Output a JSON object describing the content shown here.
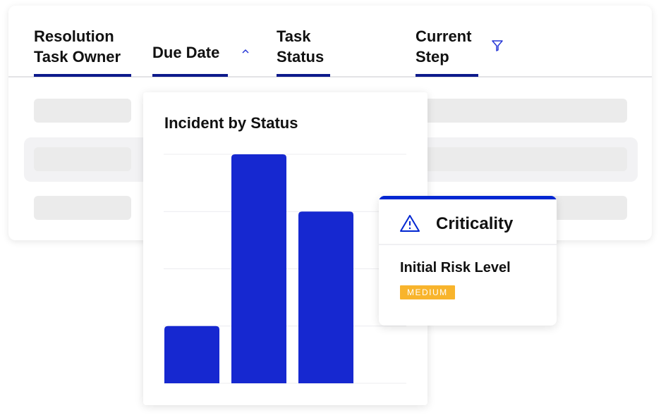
{
  "table": {
    "columns": [
      {
        "label_line1": "Resolution",
        "label_line2": "Task Owner"
      },
      {
        "label_line1": "Due Date",
        "label_line2": "",
        "icon": "sort-up-icon"
      },
      {
        "label_line1": "Task",
        "label_line2": "Status"
      },
      {
        "label_line1": "Current",
        "label_line2": "Step",
        "icon": "filter-icon"
      }
    ]
  },
  "chart_data": {
    "type": "bar",
    "title": "Incident by Status",
    "categories": [
      "",
      "",
      ""
    ],
    "values": [
      1,
      4,
      3
    ],
    "ylim": [
      0,
      4
    ],
    "grid": true,
    "bar_color": "#1628d0"
  },
  "criticality": {
    "title": "Criticality",
    "icon": "warning-triangle-icon",
    "field_label": "Initial Risk Level",
    "badge": "MEDIUM",
    "badge_color": "#f8b42c",
    "accent": "#0026d1"
  }
}
